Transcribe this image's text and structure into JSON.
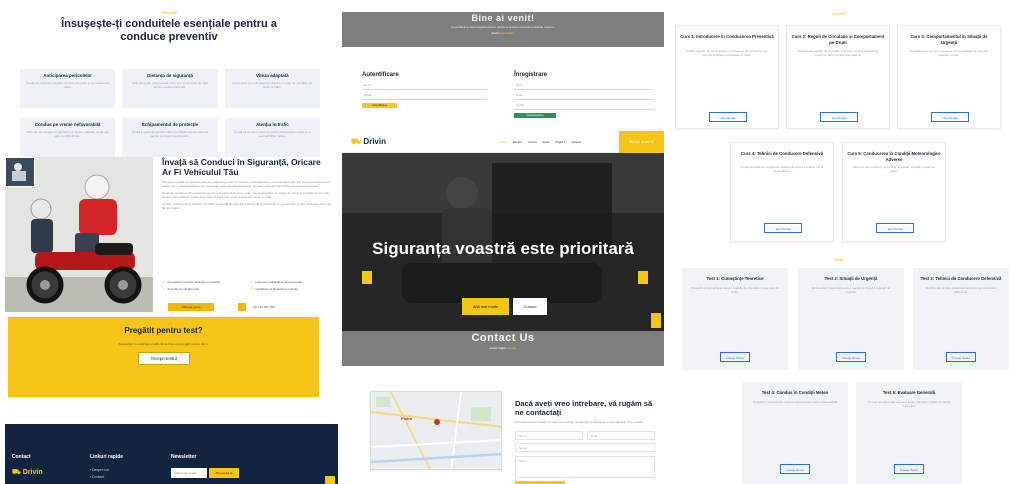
{
  "left": {
    "kicker": "Serviciile",
    "heading": "Însușește-ți conduitele esențiale pentru a conduce preventiv",
    "features": [
      {
        "title": "Anticiparea pericolelor",
        "text": "Învață să anticipezi situațiile riscante din trafic și să reacționezi rapid."
      },
      {
        "title": "Distanța de siguranță",
        "text": "Află cât spațiu este necesar între tine și vehiculul din față pentru a evita coliziunile."
      },
      {
        "title": "Viteza adaptată",
        "text": "Descoperă cum să adaptezi viteza în funcție de condițiile de drum și trafic."
      },
      {
        "title": "Condus pe vreme nefavorabilă",
        "text": "Află cum să conduci în siguranță pe ploaie, zăpadă, ceață sau alte condiții dificile."
      },
      {
        "title": "Echipamentul de protecție",
        "text": "Învață importanța purtării căștii și echipamentului adecvat pentru a preveni accidentele."
      },
      {
        "title": "Atenția în trafic",
        "text": "Învață să fii mereu atent la ceilalți participanți la trafic și la semnalizările rutiere."
      }
    ],
    "learn_title": "Învață să Conduci în Siguranță, Oricare Ar Fi Vehiculul Tău",
    "learn_paragraphs": [
      "Siguranța rutieră nu depinde doar de vehiculul pe care îl conduci, ci de atitudinea și cunoștințele tale. Fie că ești la volanul unei mașini, pe o motocicletă sau pe o bicicletă, este esențial să înțelegi riscurile și să aplici principiile condusului preventiv.",
      "Cursurile noastre sunt concepute pentru a te ajuta să devii un șofer mai responsabil, mai atent și mai bine pregătit pentru orice situație neprevăzută. Învață să anticipezi pericolele și să reacționezi corect în trafic.",
      "Lecțiile includ exerciții practice, simulări de situații de urgență și sfaturi de la instructori cu experiență, pentru ca fiecare drum să fie unul sigur."
    ],
    "checks": [
      "Cunoștințe teoretice aplicate în practică",
      "Instructori calificați și experimentați",
      "Simulări de situații reale",
      "Certificare la finalizarea cursului"
    ],
    "learn_button": "Află mai multe",
    "learn_phone": "+40 123 456 789",
    "cta_title": "Pregătit pentru test?",
    "cta_sub": "Testează-ți cunoștințele și află cât de bine ești pregătit pentru drum.",
    "cta_button": "Începe testul",
    "footer": {
      "contact_head": "Contact",
      "links_head": "Linkuri rapide",
      "newsletter_head": "Newsletter",
      "brand": "Drivin",
      "links": [
        "Despre noi",
        "Contact"
      ],
      "newsletter_placeholder": "Adresa de email",
      "newsletter_button": "Abonează-te"
    }
  },
  "mid": {
    "welcome_title": "Bine ai venit!",
    "welcome_sub": "Autentifică-te sau înregistrează-te pentru a accesa cursurile și testele noastre.",
    "welcome_bc": [
      "Acasă",
      "Autentificare"
    ],
    "login_title": "Autentificare",
    "register_title": "Înregistrare",
    "login_fields": [
      "Email",
      "Parolă"
    ],
    "login_button": "Autentifică-te",
    "register_fields": [
      "Nume",
      "Email",
      "Parolă"
    ],
    "register_button": "Înregistrează-te",
    "nav": {
      "logo": "Drivin",
      "items": [
        "Acasă",
        "Despre",
        "Cursuri",
        "Teste",
        "Pagini ▾",
        "Contact"
      ],
      "active_index": 0,
      "cta": "Începe acum ➜"
    },
    "hero": {
      "title": "Siguranța voastră este prioritară",
      "primary": "Află mai multe",
      "secondary": "Cursuri"
    },
    "contact_title": "Contact Us",
    "contact_bc": [
      "Acasă",
      "Pagini",
      "Contact"
    ],
    "map_label": "Piatra",
    "contact_q": "Dacă aveți vreo întrebare, vă rugăm să ne contactați",
    "contact_txt": "Completează formularul de mai jos și echipa noastră îți va răspunde în cel mai scurt timp posibil.",
    "contact_fields": [
      "Nume",
      "Email",
      "Subiect",
      "Mesaj"
    ]
  },
  "right": {
    "courses_kicker": "Cursuri",
    "courses": [
      {
        "title": "Curs 1: Introducere în Conducerea Preventivă",
        "text": "Învață noțiunile de bază despre conducerea preventivă și cum să eviți situațiile periculoase în trafic.",
        "button": "Vezi Detalii"
      },
      {
        "title": "Curs 2: Reguli de Circulație și Comportament pe Drum",
        "text": "Descoperă regulile de circulație esențiale și comportamentul corect pe drum pentru siguranța ta.",
        "button": "Vezi Detalii"
      },
      {
        "title": "Curs 3: Comportamentul în Situații de Urgență",
        "text": "Pregătește-te pentru a gestiona corect situațiile de urgență apărute în trafic.",
        "button": "Vezi Detalii"
      },
      {
        "title": "Curs 4: Tehnici de Conducere Defensivă",
        "text": "Învață tehnicile de conducere defensivă pentru a reduce riscul de accidente.",
        "button": "Vezi Detalii"
      },
      {
        "title": "Curs 5: Conducerea în Condiții Meteorologice Adverse",
        "text": "Află cum să conduci în siguranță pe ploaie, zăpadă, ceață sau polei.",
        "button": "Vezi Detalii"
      }
    ],
    "tests_kicker": "Teste",
    "tests": [
      {
        "title": "Test 1: Cunoștințe Teoretice",
        "text": "Testează-ți cunoștințele despre regulile de circulație și semnele de trafic.",
        "button": "Începe Testul"
      },
      {
        "title": "Test 2: Situații de Urgență",
        "text": "Evaluează-ți capacitatea de a reacționa corect în situații de urgență.",
        "button": "Începe Testul"
      },
      {
        "title": "Test 3: Tehnici de Conducere Defensivă",
        "text": "Verifică cât de bine stăpânești tehnicile de conducere defensivă.",
        "button": "Începe Testul"
      },
      {
        "title": "Test 4: Condus în Condiții Meteo",
        "text": "Testează-ți cunoștințele despre condusul pe vreme nefavorabilă.",
        "button": "Începe Testul"
      },
      {
        "title": "Test 5: Evaluare Generală",
        "text": "Un test complet care acoperă toate noțiunile învățate în cadrul cursurilor.",
        "button": "Începe Testul"
      }
    ]
  },
  "colors": {
    "accent": "#f5c518",
    "navy": "#13243f",
    "link": "#2c6fd1"
  }
}
